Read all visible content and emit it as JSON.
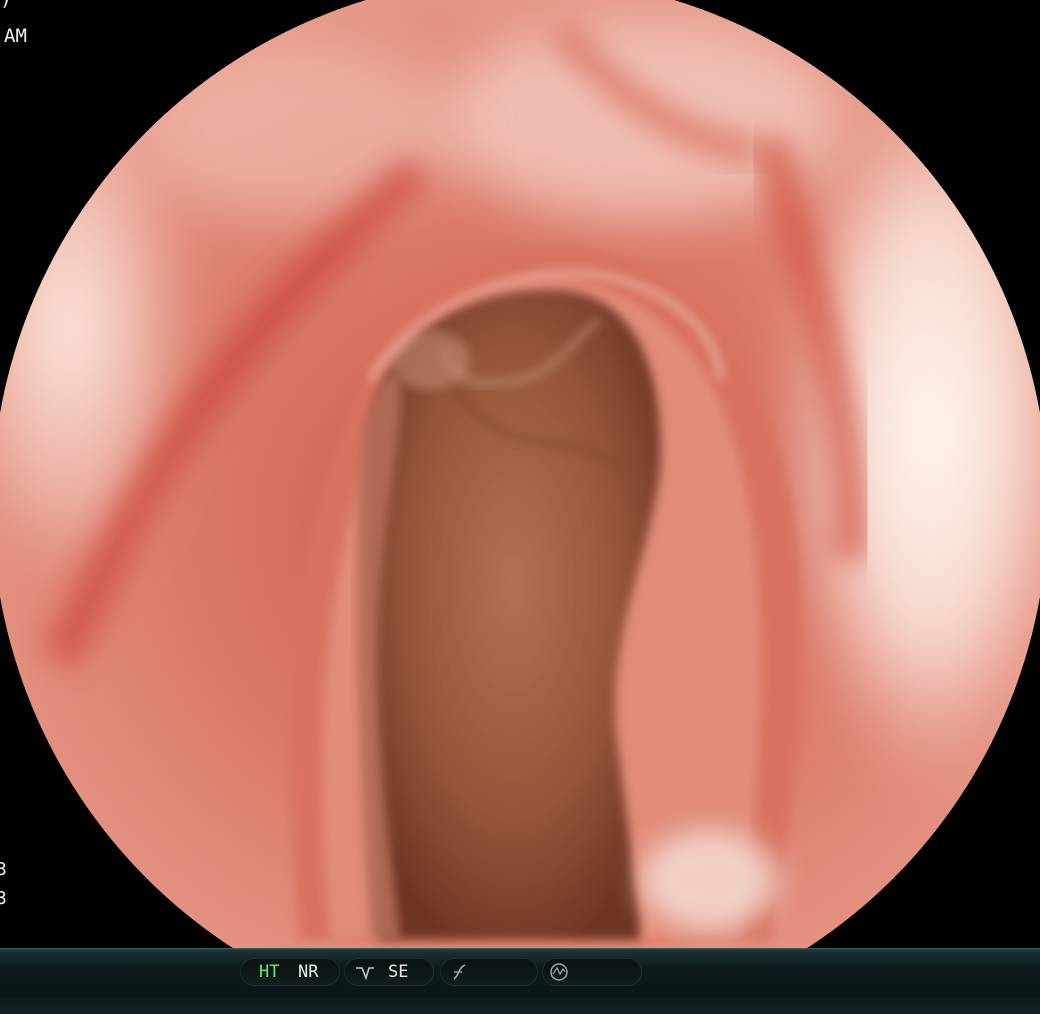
{
  "overlay": {
    "top_fragment": ")",
    "time_suffix": "AM",
    "left_line_1": "3",
    "left_line_2": "3"
  },
  "status_bar": {
    "ht_label": "HT",
    "nr_label": "NR",
    "se_label": "SE",
    "icons": [
      "enhance-icon",
      "curve-icon",
      "circle-wave-icon"
    ],
    "colors": {
      "ht_active": "#5ef072",
      "label": "#e8e8e8",
      "bar_background": "#0d1a1b"
    }
  },
  "image": {
    "subject": "endoscopic-view",
    "colors": {
      "mucosa": "#d66a5a",
      "highlight": "#f6e8e0",
      "lumen": "#8c4a30"
    }
  }
}
